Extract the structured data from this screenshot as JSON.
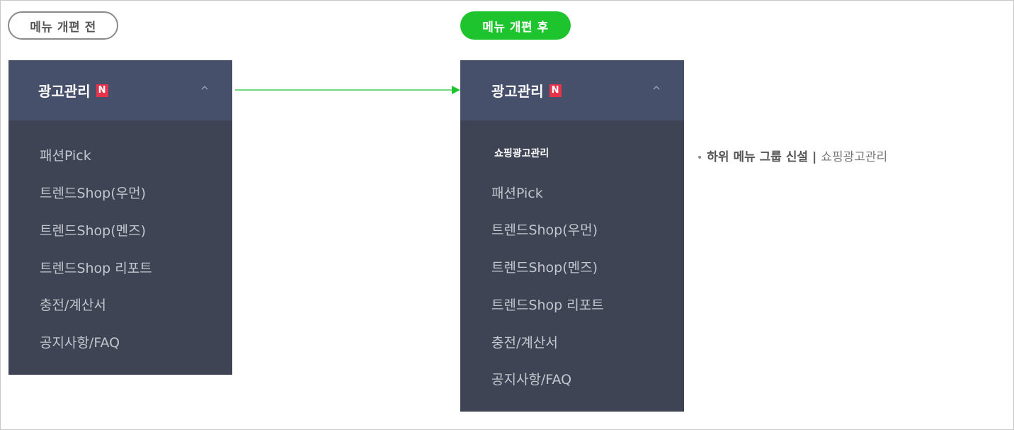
{
  "labels": {
    "before": "메뉴 개편 전",
    "after": "메뉴 개편 후"
  },
  "colors": {
    "after_pill": "#1ec42e",
    "arrow": "#1ec42e",
    "panel_bg": "#3e4454",
    "panel_header_bg": "#46506a",
    "new_badge": "#e8344a"
  },
  "before_menu": {
    "title": "광고관리",
    "badge": "N",
    "items": [
      "패션Pick",
      "트렌드Shop(우먼)",
      "트렌드Shop(멘즈)",
      "트렌드Shop 리포트",
      "충전/계산서",
      "공지사항/FAQ"
    ]
  },
  "after_menu": {
    "title": "광고관리",
    "badge": "N",
    "sub_group": "쇼핑광고관리",
    "items": [
      "패션Pick",
      "트렌드Shop(우먼)",
      "트렌드Shop(멘즈)",
      "트렌드Shop 리포트",
      "충전/계산서",
      "공지사항/FAQ"
    ]
  },
  "note": {
    "bullet": "•",
    "strong": "하위 메뉴 그룹 신설",
    "separator": "|",
    "light": "쇼핑광고관리"
  }
}
